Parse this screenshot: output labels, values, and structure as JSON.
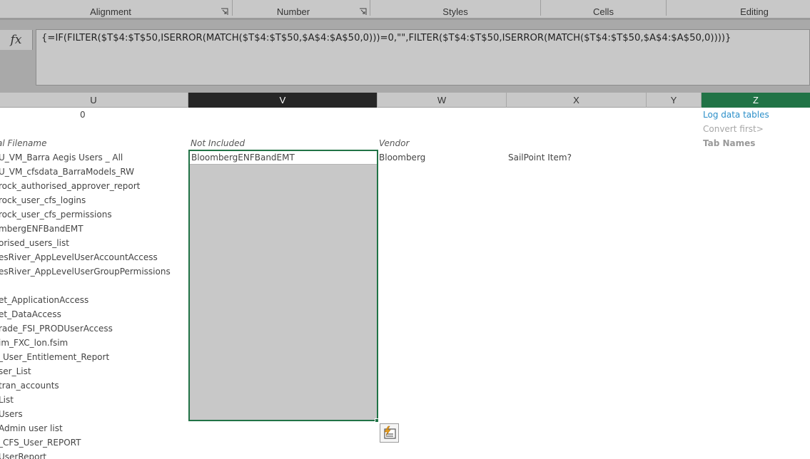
{
  "ribbon": {
    "groups": [
      {
        "label": "Alignment",
        "launcher": true
      },
      {
        "label": "Number",
        "launcher": true
      },
      {
        "label": "Styles",
        "launcher": false
      },
      {
        "label": "Cells",
        "launcher": false
      },
      {
        "label": "Editing",
        "launcher": false
      }
    ]
  },
  "formula_bar": {
    "fx_label": "fx",
    "formula": "{=IF(FILTER($T$4:$T$50,ISERROR(MATCH($T$4:$T$50,$A$4:$A$50,0)))=0,\"\",FILTER($T$4:$T$50,ISERROR(MATCH($T$4:$T$50,$A$4:$A$50,0))))}"
  },
  "columns": [
    "U",
    "V",
    "W",
    "X",
    "Y",
    "Z"
  ],
  "selected_column": "V",
  "active_column": "Z",
  "cells": {
    "u_top": "0",
    "z_link": "Log data tables",
    "z_convert": "Convert first>",
    "z_tabnames": "Tab Names",
    "left_header": "al Filename",
    "v_header": "Not Included",
    "w_header": "Vendor",
    "v_first": "BloombergENFBandEMT",
    "w_first": "Bloomberg",
    "x_first": "SailPoint Item?"
  },
  "filenames": [
    "U_VM_Barra Aegis Users _ All",
    "U_VM_cfsdata_BarraModels_RW",
    "rock_authorised_approver_report",
    "rock_user_cfs_logins",
    "rock_user_cfs_permissions",
    "mbergENFBandEMT",
    "orised_users_list",
    "esRiver_AppLevelUserAccountAccess",
    "esRiver_AppLevelUserGroupPermissions",
    "",
    "et_ApplicationAccess",
    "et_DataAccess",
    "rade_FSI_PRODUserAccess",
    "im_FXC_lon.fsim",
    "_User_Entitlement_Report",
    "ser_List",
    "tran_accounts",
    "List",
    " Users",
    " Admin user list",
    "_CFS_User_REPORT",
    "UserReport"
  ],
  "icons": {
    "launcher": "dialog-launcher-icon",
    "quick_analysis": "quick-analysis-icon"
  },
  "colors": {
    "accent_green": "#217346",
    "link_blue": "#2b8fc9"
  }
}
